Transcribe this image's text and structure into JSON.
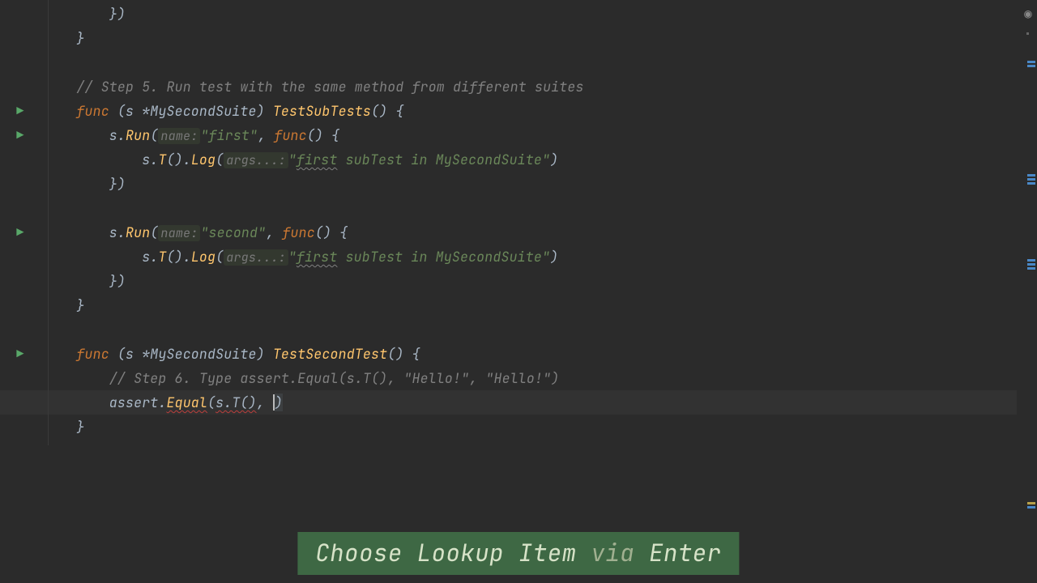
{
  "code": {
    "l1": "        })",
    "l2": "    }",
    "l3_cmt": "// Step 5. Run test with the same method from different suites",
    "l4_func": "func",
    "l4_recv": " (s *MySecondSuite) ",
    "l4_name": "TestSubTests",
    "l4_tail": "() {",
    "l5_pre": "        s.",
    "l5_run": "Run",
    "l5_hint": "name:",
    "l5_str": "\"first\"",
    "l5_mid": ", ",
    "l5_func": "func",
    "l5_tail": "() {",
    "l6_pre": "            s.",
    "l6_T": "T",
    "l6_mid1": "().",
    "l6_Log": "Log",
    "l6_hint": "args...:",
    "l6_str_a": "\"",
    "l6_str_b": "first",
    "l6_str_c": " subTest in MySecondSuite\"",
    "l6_close": ")",
    "l7": "        })",
    "l9_pre": "        s.",
    "l9_run": "Run",
    "l9_hint": "name:",
    "l9_str": "\"second\"",
    "l9_mid": ", ",
    "l9_func": "func",
    "l9_tail": "() {",
    "l10_pre": "            s.",
    "l10_T": "T",
    "l10_mid1": "().",
    "l10_Log": "Log",
    "l10_hint": "args...:",
    "l10_str_a": "\"",
    "l10_str_b": "first",
    "l10_str_c": " subTest in MySecondSuite\"",
    "l10_close": ")",
    "l11": "        })",
    "l12": "    }",
    "l14_func": "func",
    "l14_recv": " (s *MySecondSuite) ",
    "l14_name": "TestSecondTest",
    "l14_tail": "() {",
    "l15_cmt": "// Step 6. Type assert.Equal(s.T(), \"Hello!\", \"Hello!\")",
    "l16_pre": "        assert.",
    "l16_eq": "Equal",
    "l16_open": "(",
    "l16_arg": "s.T()",
    "l16_comma": ", ",
    "l16_close": ")",
    "l17": "    }"
  },
  "banner": {
    "a": "Choose Lookup Item",
    "b": " via ",
    "c": "Enter"
  }
}
